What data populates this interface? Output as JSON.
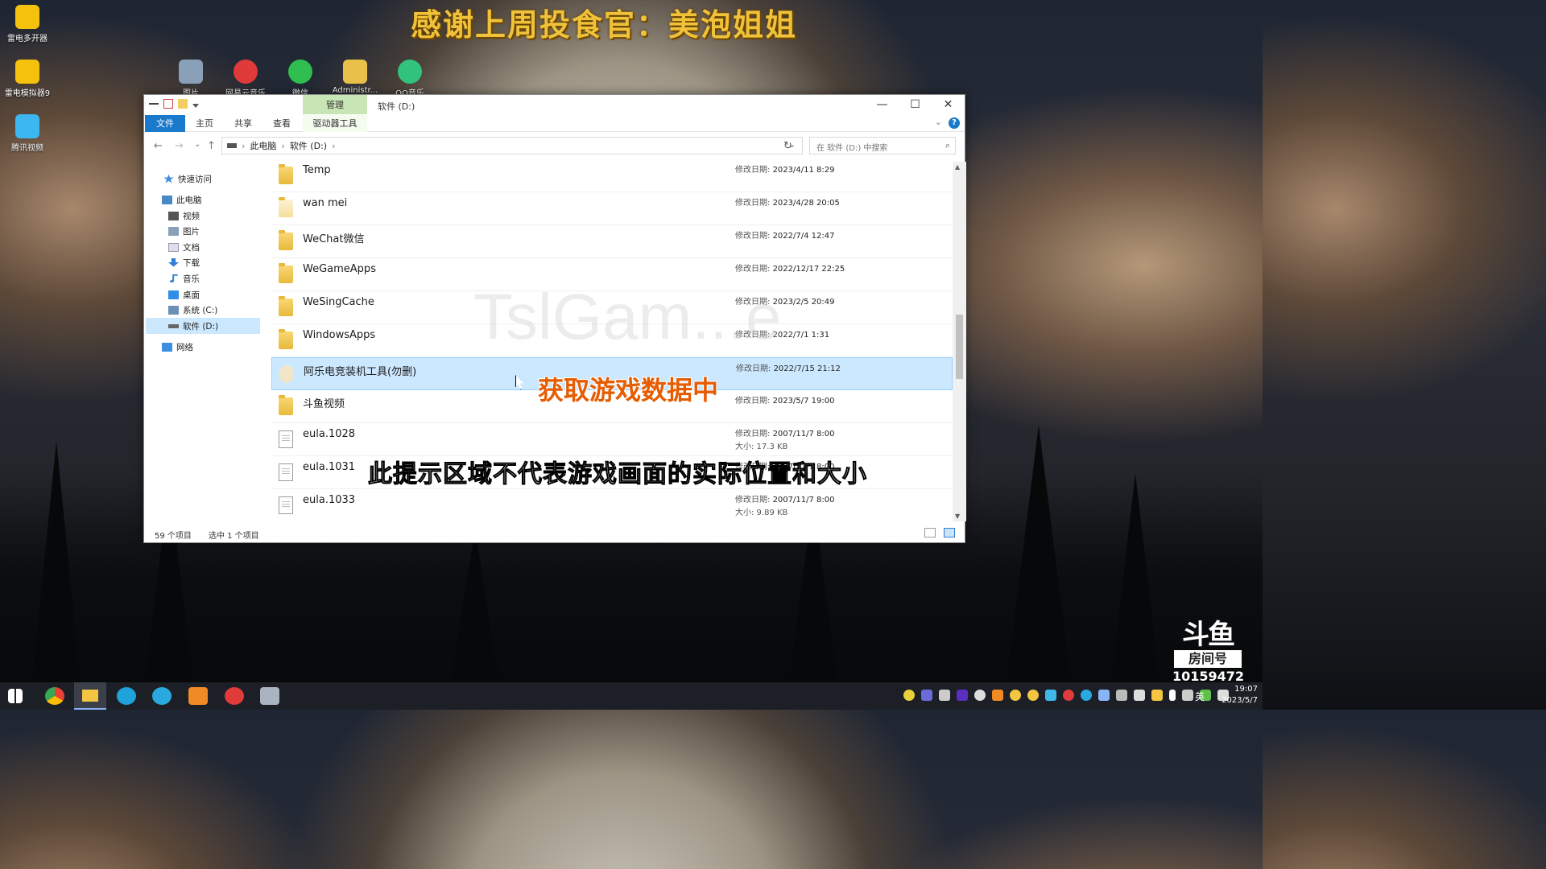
{
  "banner": "感谢上周投食官：美泡姐姐",
  "desktop_icons_left": [
    {
      "label": "雷电多开器",
      "color": "#f4c20d"
    },
    {
      "label": "雷电模拟器9",
      "color": "#f4c20d"
    },
    {
      "label": "腾讯视频",
      "color": "#3db7f0"
    }
  ],
  "desktop_icons_top": [
    {
      "label": "图片",
      "color": "#8aa0b8"
    },
    {
      "label": "网易云音乐",
      "color": "#e13a3a"
    },
    {
      "label": "微信",
      "color": "#2fbe4f"
    },
    {
      "label": "Administr...",
      "color": "#e8c04a"
    },
    {
      "label": "QQ音乐",
      "color": "#31c27c"
    }
  ],
  "explorer": {
    "context_tab": "管理",
    "title": "软件 (D:)",
    "ribbon_tabs": [
      "文件",
      "主页",
      "共享",
      "查看",
      "驱动器工具"
    ],
    "window_controls": {
      "minimize": "—",
      "maximize": "☐",
      "close": "✕"
    },
    "nav": {
      "back": "←",
      "forward": "→",
      "recent": "⌄",
      "up": "↑"
    },
    "breadcrumb": [
      "此电脑",
      "软件 (D:)"
    ],
    "search_placeholder": "在 软件 (D:) 中搜索",
    "tree": [
      {
        "label": "快速访问",
        "color": "#3c8ee0"
      },
      {
        "label": "此电脑",
        "color": "#4a88c7"
      },
      {
        "label": "视频",
        "color": "#555"
      },
      {
        "label": "图片",
        "color": "#8aa0b8"
      },
      {
        "label": "文档",
        "color": "#aab"
      },
      {
        "label": "下载",
        "color": "#2f7fd6"
      },
      {
        "label": "音乐",
        "color": "#2f7fd6"
      },
      {
        "label": "桌面",
        "color": "#2f8fe6"
      },
      {
        "label": "系统 (C:)",
        "color": "#6b8fb5"
      },
      {
        "label": "软件 (D:)",
        "color": "#666"
      },
      {
        "label": "网络",
        "color": "#3c8ee0"
      }
    ],
    "files": [
      {
        "name": "Temp",
        "type": "folder",
        "date_label": "修改日期:",
        "date": "2023/4/11 8:29",
        "size": ""
      },
      {
        "name": "wan mei",
        "type": "folder",
        "date_label": "修改日期:",
        "date": "2023/4/28 20:05",
        "size": ""
      },
      {
        "name": "WeChat微信",
        "type": "folder",
        "date_label": "修改日期:",
        "date": "2022/7/4 12:47",
        "size": ""
      },
      {
        "name": "WeGameApps",
        "type": "folder",
        "date_label": "修改日期:",
        "date": "2022/12/17 22:25",
        "size": ""
      },
      {
        "name": "WeSingCache",
        "type": "folder",
        "date_label": "修改日期:",
        "date": "2023/2/5 20:49",
        "size": ""
      },
      {
        "name": "WindowsApps",
        "type": "folder",
        "date_label": "修改日期:",
        "date": "2022/7/1 1:31",
        "size": ""
      },
      {
        "name": "阿乐电竞装机工具(勿删)",
        "type": "folder",
        "date_label": "修改日期:",
        "date": "2022/7/15 21:12",
        "size": ""
      },
      {
        "name": "斗鱼视频",
        "type": "folder",
        "date_label": "修改日期:",
        "date": "2023/5/7 19:00",
        "size": ""
      },
      {
        "name": "eula.1028",
        "type": "file",
        "date_label": "修改日期:",
        "date": "2007/11/7 8:00",
        "size": "大小: 17.3 KB"
      },
      {
        "name": "eula.1031",
        "type": "file",
        "date_label": "修改日期:",
        "date": "2007/11/7 8:00",
        "size": ""
      },
      {
        "name": "eula.1033",
        "type": "file",
        "date_label": "修改日期:",
        "date": "2007/11/7 8:00",
        "size": "大小: 9.89 KB"
      }
    ],
    "status_count": "59 个项目",
    "status_selected": "选中 1 个项目"
  },
  "overlays": {
    "loading": "获取游戏数据中",
    "notice": "此提示区域不代表游戏画面的实际位置和大小",
    "watermark": "TslGam...e"
  },
  "douyu": {
    "logo": "斗鱼",
    "room_label": "房间号",
    "room_number": "10159472"
  },
  "taskbar": {
    "apps": [
      {
        "name": "start",
        "color": "#ffffff"
      },
      {
        "name": "chrome",
        "color": "#e94235"
      },
      {
        "name": "explorer",
        "color": "#f4c542"
      },
      {
        "name": "edge",
        "color": "#1fa3d8"
      },
      {
        "name": "app-blue",
        "color": "#2aa9e0"
      },
      {
        "name": "app-orange",
        "color": "#f08a24"
      },
      {
        "name": "netease-music",
        "color": "#e13a3a"
      },
      {
        "name": "app-gray",
        "color": "#aab4c0"
      }
    ],
    "ime": "英",
    "time": "19:07",
    "date": "2023/5/7"
  }
}
